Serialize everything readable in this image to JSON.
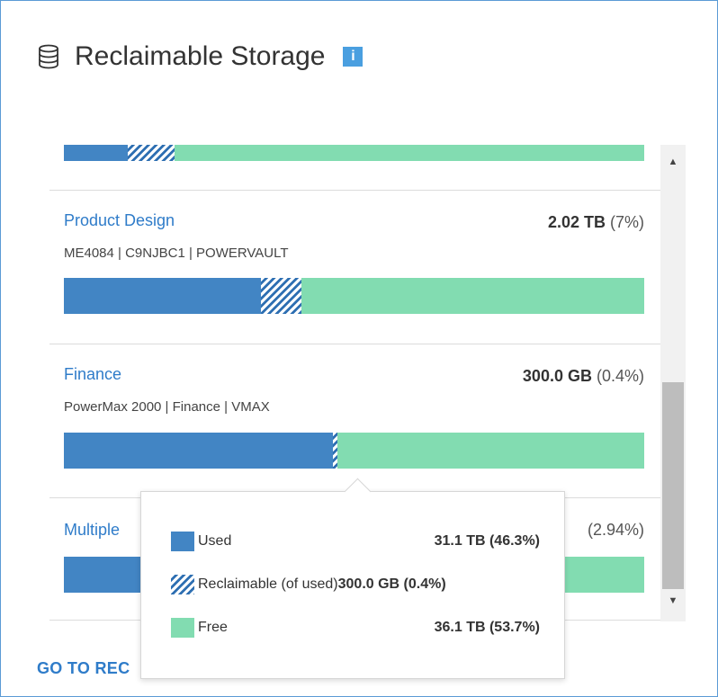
{
  "header": {
    "title": "Reclaimable Storage",
    "info_label": "i",
    "icon": "database-icon"
  },
  "rows": [
    {
      "name": "",
      "subtitle": "",
      "value_bold": "",
      "value_pct": "",
      "bar": {
        "used": 0.11,
        "reclaimable": 0.08,
        "free": 0.81
      }
    },
    {
      "name": "Product Design",
      "subtitle": "ME4084 | C9NJBC1 | POWERVAULT",
      "value_bold": "2.02 TB",
      "value_pct": "(7%)",
      "bar": {
        "used": 0.34,
        "reclaimable": 0.07,
        "free": 0.59
      }
    },
    {
      "name": "Finance",
      "subtitle": "PowerMax 2000 | Finance | VMAX",
      "value_bold": "300.0 GB",
      "value_pct": "(0.4%)",
      "bar": {
        "used": 0.463,
        "reclaimable": 0.004,
        "free": 0.533
      }
    },
    {
      "name": "Multiple",
      "subtitle": "",
      "value_bold": "",
      "value_pct": "(2.94%)",
      "bar": {
        "used": 0.4,
        "reclaimable": 0.0,
        "free": 0.6
      }
    }
  ],
  "tooltip": {
    "items": [
      {
        "label": "Used",
        "value": "31.1 TB (46.3%)",
        "swatch": "used"
      },
      {
        "label": "Reclaimable (of used)",
        "value": "300.0 GB (0.4%)",
        "swatch": "reclaimable"
      },
      {
        "label": "Free",
        "value": "36.1 TB (53.7%)",
        "swatch": "free"
      }
    ]
  },
  "footer": {
    "link_text": "GO TO REC"
  },
  "colors": {
    "used": "#4285c4",
    "reclaimable_stripe": "#2e6fb2",
    "free": "#82dcb1",
    "link": "#2f7cc9",
    "info": "#4a9fe0"
  }
}
